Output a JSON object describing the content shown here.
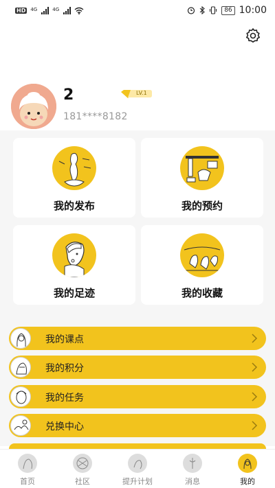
{
  "status_bar": {
    "network_badge": "HD",
    "net_label_1": "4G",
    "net_label_2": "4G",
    "battery": "86",
    "time": "10:00"
  },
  "header": {
    "settings_icon": "gear-icon"
  },
  "profile": {
    "username": "2",
    "level": "LV.1",
    "phone": "181****8182",
    "accent_color": "#f2c31d"
  },
  "cards": [
    {
      "label": "我的发布",
      "icon": "venus-illustration-icon"
    },
    {
      "label": "我的预约",
      "icon": "calendar-illustration-icon"
    },
    {
      "label": "我的足迹",
      "icon": "pearl-earring-illustration-icon"
    },
    {
      "label": "我的收藏",
      "icon": "gleaners-illustration-icon"
    }
  ],
  "menu": [
    {
      "label": "我的课点",
      "icon": "sketch-portrait-icon"
    },
    {
      "label": "我的积分",
      "icon": "sketch-figure-icon"
    },
    {
      "label": "我的任务",
      "icon": "sketch-face-icon"
    },
    {
      "label": "兑换中心",
      "icon": "sketch-scene-icon"
    }
  ],
  "tabs": [
    {
      "label": "首页",
      "active": false
    },
    {
      "label": "社区",
      "active": false
    },
    {
      "label": "提升计划",
      "active": false
    },
    {
      "label": "消息",
      "active": false
    },
    {
      "label": "我的",
      "active": true
    }
  ]
}
